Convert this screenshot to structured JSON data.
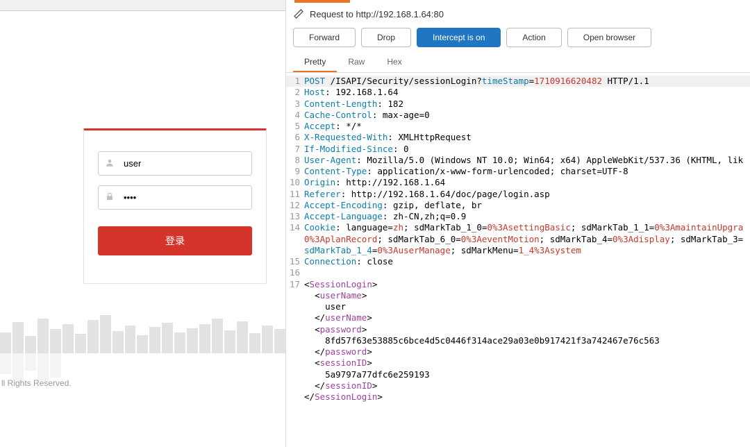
{
  "login": {
    "username_value": "user",
    "password_value": "••••",
    "button_label": "登录",
    "footer": "ll Rights Reserved."
  },
  "intercept": {
    "title": "Request to http://192.168.1.64:80",
    "buttons": {
      "forward": "Forward",
      "drop": "Drop",
      "intercept": "Intercept is on",
      "action": "Action",
      "open_browser": "Open browser"
    },
    "tabs": {
      "pretty": "Pretty",
      "raw": "Raw",
      "hex": "Hex"
    },
    "request": {
      "method": "POST",
      "path": " /ISAPI/Security/sessionLogin?",
      "ts_key": "timeStamp",
      "ts_val": "1710916620482",
      "http": " HTTP/1.1",
      "host_h": "Host",
      "host_v": ": 192.168.1.64",
      "cl_h": "Content-Length",
      "cl_v": ": 182",
      "cc_h": "Cache-Control",
      "cc_v": ": max-age=0",
      "ac_h": "Accept",
      "ac_v": ": */*",
      "xr_h": "X-Requested-With",
      "xr_v": ": XMLHttpRequest",
      "im_h": "If-Modified-Since",
      "im_v": ": 0",
      "ua_h": "User-Agent",
      "ua_v": ": Mozilla/5.0 (Windows NT 10.0; Win64; x64) AppleWebKit/537.36 (KHTML, lik",
      "ct_h": "Content-Type",
      "ct_v": ": application/x-www-form-urlencoded; charset=UTF-8",
      "or_h": "Origin",
      "or_v": ": http://192.168.1.64",
      "rf_h": "Referer",
      "rf_v": ": http://192.168.1.64/doc/page/login.asp",
      "ae_h": "Accept-Encoding",
      "ae_v": ": gzip, deflate, br",
      "al_h": "Accept-Language",
      "al_v": ": zh-CN,zh;q=0.9",
      "ck_h": "Cookie",
      "ck_1": ": language=",
      "ck_1v": "zh",
      "ck_2": "; sdMarkTab_1_0=",
      "ck_2v": "0%3AsettingBasic",
      "ck_3": "; sdMarkTab_1_1=",
      "ck_3v": "0%3AmaintainUpgra",
      "ck_l2a": "0%3AplanRecord",
      "ck_l2b": "; sdMarkTab_6_0=",
      "ck_l2bv": "0%3AeventMotion",
      "ck_l2c": "; sdMarkTab_4=",
      "ck_l2cv": "0%3Adisplay",
      "ck_l2d": "; sdMarkTab_3=",
      "ck_l3a": "sdMarkTab_1_4",
      "ck_l3av": "=",
      "ck_l3av2": "0%3AuserManage",
      "ck_l3b": "; sdMarkMenu=",
      "ck_l3bv": "1_4%3Asystem",
      "cn_h": "Connection",
      "cn_v": ": close",
      "xml_open": "<",
      "xml_close": ">",
      "xml_closetag": "</",
      "sl": "SessionLogin",
      "un": "userName",
      "un_val": "    user",
      "pw": "password",
      "pw_val": "    8fd57f63e53885c6bce4d5c0446f314ace29a03e0b917421f3a742467e76c563",
      "sid": "sessionID",
      "sid_val": "    5a9797a77dfc6e259193",
      "indent1": "  ",
      "gt": ">"
    }
  }
}
